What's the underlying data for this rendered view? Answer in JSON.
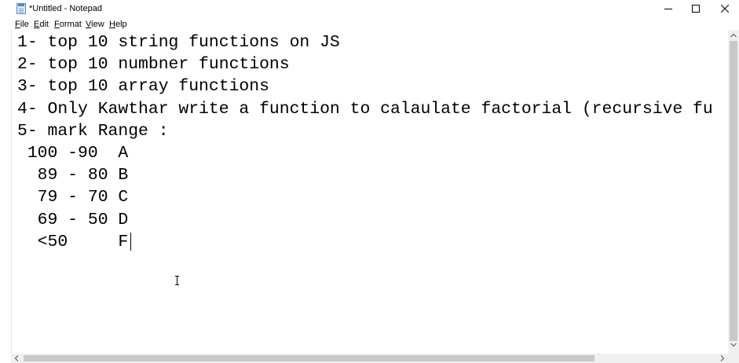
{
  "window": {
    "title": "*Untitled - Notepad",
    "icon": "notepad-icon",
    "controls": [
      "minimize-icon",
      "maximize-icon",
      "close-icon"
    ]
  },
  "menu": {
    "file": {
      "mnemonic": "F",
      "rest": "ile"
    },
    "edit": {
      "mnemonic": "E",
      "rest": "dit"
    },
    "format": {
      "mnemonic": "F",
      "rest": "ormat"
    },
    "view": {
      "mnemonic": "V",
      "rest": "iew"
    },
    "help": {
      "mnemonic": "H",
      "rest": "elp"
    }
  },
  "editor": {
    "content": "1- top 10 string functions on JS\n2- top 10 numbner functions\n3- top 10 array functions\n4- Only Kawthar write a function to calaulate factorial (recursive fu\n5- mark Range :\n 100 -90  A\n  89 - 80 B\n  79 - 70 C\n  69 - 50 D\n  <50     F"
  },
  "colors": {
    "scrollbar_track": "#f0f0f0",
    "scrollbar_thumb": "#c8c8c8",
    "text": "#000000"
  }
}
